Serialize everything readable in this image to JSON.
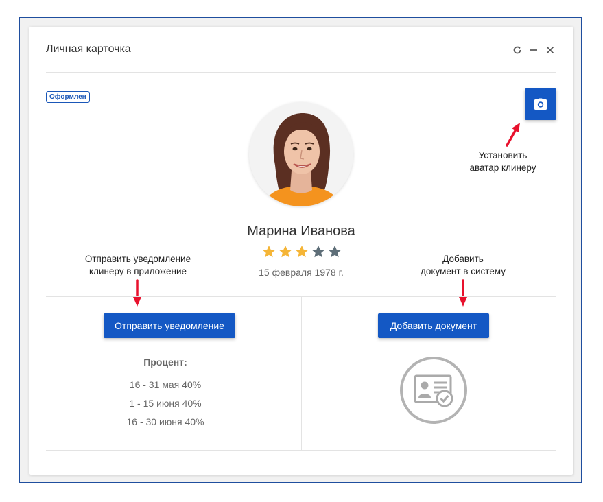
{
  "card": {
    "title": "Личная карточка",
    "status_badge": "Оформлен",
    "controls": [
      "refresh-icon",
      "minimize-icon",
      "close-icon"
    ]
  },
  "profile": {
    "name": "Марина Иванова",
    "rating": 3,
    "rating_max": 5,
    "birth_date": "15 февраля 1978 г."
  },
  "annotations": {
    "avatar_line1": "Установить",
    "avatar_line2": "аватар клинеру",
    "notify_line1": "Отправить уведомление",
    "notify_line2": "клинеру в приложение",
    "doc_line1": "Добавить",
    "doc_line2": "документ в систему"
  },
  "actions": {
    "notify_label": "Отправить уведомление",
    "add_document_label": "Добавить документ"
  },
  "percent": {
    "title": "Процент:",
    "lines": [
      "16 - 31 мая 40%",
      "1 - 15 июня 40%",
      "16 - 30 июня 40%"
    ]
  },
  "colors": {
    "accent": "#1458c4",
    "star_active": "#f5b537",
    "star_inactive": "#5e6e78",
    "arrow": "#e8112d"
  }
}
